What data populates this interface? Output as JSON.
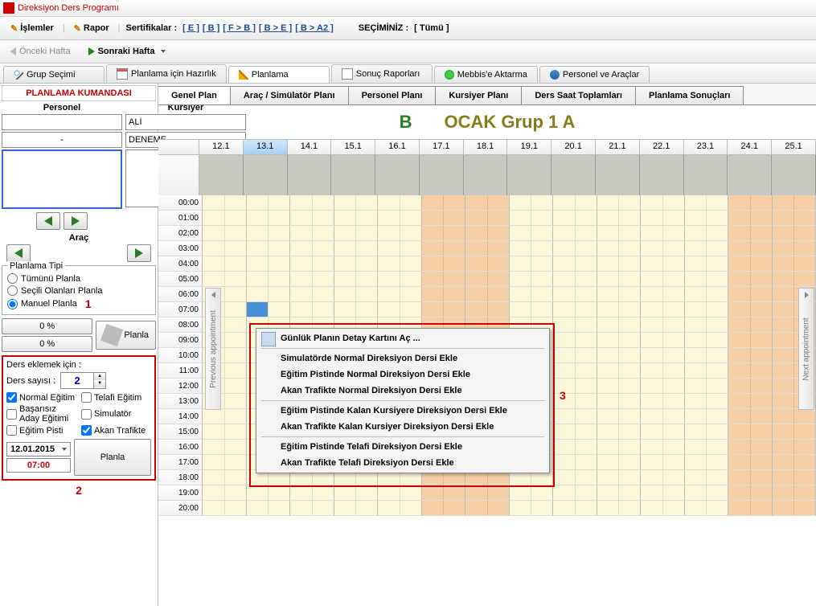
{
  "window": {
    "title": "Direksiyon Ders Programı"
  },
  "menu": {
    "islemler": "İşlemler",
    "rapor": "Rapor",
    "sertifikalar_label": "Sertifikalar :",
    "certs": [
      "[  E  ]",
      "[  B  ]",
      "[  F > B  ]",
      "[  B > E  ]",
      "[  B > A2  ]"
    ],
    "seciminiz_label": "SEÇİMİNİZ :",
    "seciminiz_value": "[  Tümü  ]"
  },
  "nav": {
    "prev": "Önceki Hafta",
    "next": "Sonraki Hafta"
  },
  "main_tabs": {
    "grup": "Grup Seçimi",
    "hazirlik": "Planlama için Hazırlık",
    "planlama": "Planlama",
    "sonuc": "Sonuç Raporları",
    "mebbis": "Mebbis'e Aktarma",
    "personel": "Personel ve Araçlar"
  },
  "sidebar": {
    "title": "PLANLAMA KUMANDASI",
    "personel_label": "Personel",
    "kursiyer_label": "Kursiyer",
    "personel_value": "",
    "kursiyer_value": "ALİ",
    "dash": "-",
    "deneme": "DENEME",
    "arac_label": "Araç",
    "plan_tipi_title": "Planlama Tipi",
    "tumunu": "Tümünü Planla",
    "secili": "Seçili Olanları Planla",
    "manuel": "Manuel Planla",
    "num1": "1",
    "pct_a": "0 %",
    "pct_b": "0 %",
    "planla": "Planla",
    "ders_eklemek": "Ders eklemek için :",
    "ders_sayisi": "Ders sayısı :",
    "ders_count": "2",
    "chk_normal": "Normal Eğitim",
    "chk_telafi": "Telafi Eğitim",
    "chk_basarisiz": "Başarısız Aday Eğitimi",
    "chk_simulator": "Simulatör",
    "chk_pist": "Eğitim Pisti",
    "chk_trafik": "Akan Trafikte",
    "date": "12.01.2015",
    "time": "07:00",
    "num2": "2"
  },
  "subtabs": {
    "genel": "Genel Plan",
    "arac": "Araç / Simülatör Planı",
    "personel": "Personel Planı",
    "kursiyer": "Kursiyer Planı",
    "saat": "Ders Saat Toplamları",
    "sonuc": "Planlama Sonuçları"
  },
  "plan_header": {
    "b": "B",
    "title": "OCAK Grup 1 A"
  },
  "calendar": {
    "days": [
      "12.1",
      "13.1",
      "14.1",
      "15.1",
      "16.1",
      "17.1",
      "18.1",
      "19.1",
      "20.1",
      "21.1",
      "22.1",
      "23.1",
      "24.1",
      "25.1"
    ],
    "selected_day_index": 1,
    "weekend_indices": [
      5,
      6,
      12,
      13
    ],
    "hours": [
      "00:00",
      "01:00",
      "02:00",
      "03:00",
      "04:00",
      "05:00",
      "06:00",
      "07:00",
      "08:00",
      "09:00",
      "10:00",
      "11:00",
      "12:00",
      "13:00",
      "14:00",
      "15:00",
      "16:00",
      "17:00",
      "18:00",
      "19:00",
      "20:00"
    ]
  },
  "side_handles": {
    "prev": "Previous appointment",
    "next": "Next appointment"
  },
  "context_menu": {
    "items": [
      "Günlük Planın Detay Kartını Aç ...",
      "-",
      "Simulatörde Normal Direksiyon Dersi Ekle",
      "Eğitim Pistinde Normal Direksiyon Dersi Ekle",
      "Akan Trafikte Normal Direksiyon Dersi Ekle",
      "-",
      "Eğitim Pistinde Kalan Kursiyere Direksiyon Dersi Ekle",
      "Akan Trafikte Kalan Kursiyer Direksiyon Dersi Ekle",
      "-",
      "Eğitim Pistinde Telafi Direksiyon Dersi Ekle",
      "Akan Trafikte Telafi Direksiyon Dersi Ekle"
    ],
    "callout": "3"
  }
}
